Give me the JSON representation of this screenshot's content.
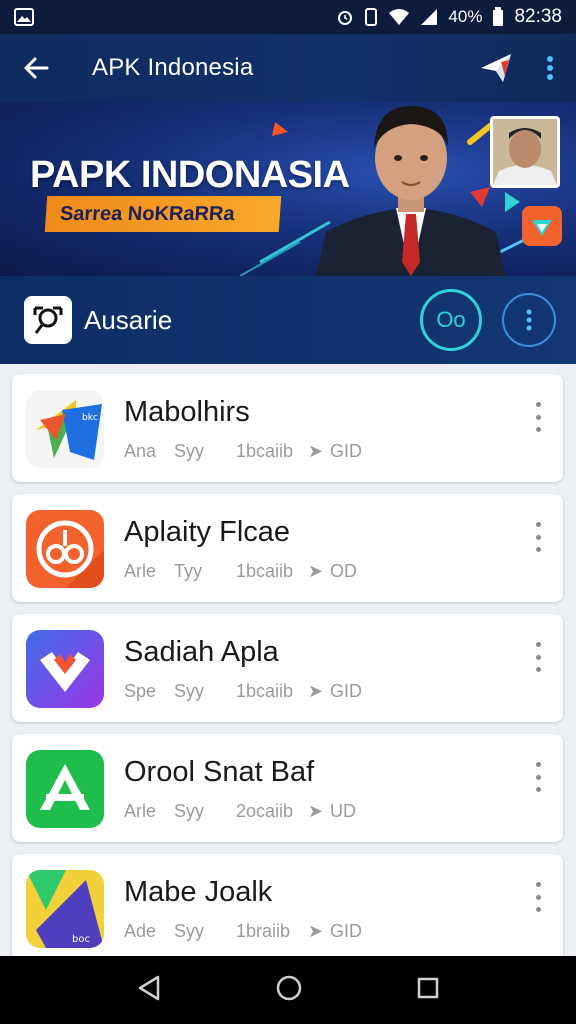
{
  "status_bar": {
    "battery": "40%",
    "time": "82:38",
    "icons": [
      "image-icon",
      "alarm-icon",
      "vibrate-icon",
      "wifi-icon",
      "signal-icon",
      "battery-icon"
    ]
  },
  "app_bar": {
    "title": "APK Indonesia",
    "back_icon": "back-arrow-icon",
    "share_icon": "send-icon",
    "menu_icon": "more-vert-icon"
  },
  "banner": {
    "headline": "PAPK INDONASIA",
    "tagline": "Sarrea NoKRaRRa"
  },
  "section": {
    "label": "Ausarie",
    "action_label": "Oo"
  },
  "apps": [
    {
      "name": "Mabolhirs",
      "meta_a": "Ana",
      "meta_b": "Syy",
      "meta_c": "1bcaiib",
      "meta_d": "GID",
      "icon": "arrow-app-icon",
      "colors": [
        "#e8582c",
        "#1fa0e8",
        "#f2c523"
      ]
    },
    {
      "name": "Aplaity Flcae",
      "meta_a": "Arle",
      "meta_b": "Tyy",
      "meta_c": "1bcaiib",
      "meta_d": "OD",
      "icon": "circle-app-icon",
      "colors": [
        "#f2622c",
        "#fff"
      ]
    },
    {
      "name": "Sadiah Apla",
      "meta_a": "Spe",
      "meta_b": "Syy",
      "meta_c": "1bcaiib",
      "meta_d": "GID",
      "icon": "check-app-icon",
      "colors": [
        "#3f6de6",
        "#9c36e6",
        "#f25533"
      ]
    },
    {
      "name": "Orool Snat Baf",
      "meta_a": "Arle",
      "meta_b": "Syy",
      "meta_c": "2ocaiib",
      "meta_d": "UD",
      "icon": "a-app-icon",
      "colors": [
        "#1fbd4c",
        "#fff"
      ]
    },
    {
      "name": "Mabe Joalk",
      "meta_a": "Ade",
      "meta_b": "Syy",
      "meta_c": "1braiib",
      "meta_d": "GID",
      "icon": "fold-app-icon",
      "colors": [
        "#f2d03a",
        "#4f3fbf",
        "#2ec96b"
      ]
    }
  ],
  "nav": {
    "back": "nav-back-icon",
    "home": "nav-home-icon",
    "recents": "nav-recents-icon"
  }
}
